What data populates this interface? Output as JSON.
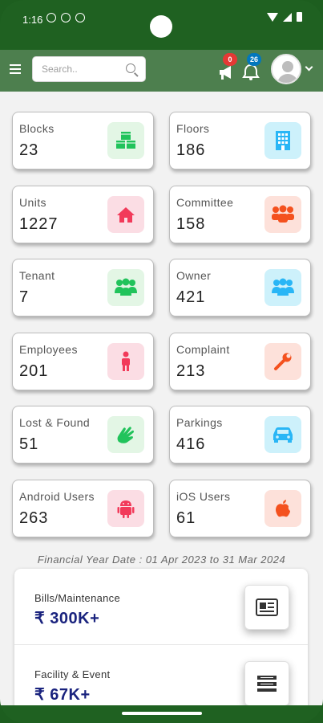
{
  "status": {
    "time": "1:16"
  },
  "search": {
    "placeholder": "Search.."
  },
  "notifications": [
    {
      "icon": "megaphone-icon",
      "badge": "0",
      "color": "#e53935"
    },
    {
      "icon": "bell-icon",
      "badge": "26",
      "color": "#0277bd"
    }
  ],
  "cards": [
    {
      "label": "Blocks",
      "value": "23",
      "icon": "cubes-icon",
      "bg": "#e3f6e5",
      "fg": "#21c35b"
    },
    {
      "label": "Floors",
      "value": "186",
      "icon": "building-icon",
      "bg": "#cdf1fb",
      "fg": "#29b6f6"
    },
    {
      "label": "Units",
      "value": "1227",
      "icon": "home-icon",
      "bg": "#fbdde4",
      "fg": "#f23a5a"
    },
    {
      "label": "Committee",
      "value": "158",
      "icon": "group-icon",
      "bg": "#fde1da",
      "fg": "#f4511e"
    },
    {
      "label": "Tenant",
      "value": "7",
      "icon": "users-icon",
      "bg": "#e3f6e5",
      "fg": "#21c35b"
    },
    {
      "label": "Owner",
      "value": "421",
      "icon": "users-icon",
      "bg": "#cdf1fb",
      "fg": "#29b6f6"
    },
    {
      "label": "Employees",
      "value": "201",
      "icon": "person-icon",
      "bg": "#fbdde4",
      "fg": "#f23a5a"
    },
    {
      "label": "Complaint",
      "value": "213",
      "icon": "wrench-icon",
      "bg": "#fde1da",
      "fg": "#f4511e"
    },
    {
      "label": "Lost & Found",
      "value": "51",
      "icon": "hand-icon",
      "bg": "#e3f6e5",
      "fg": "#21c35b"
    },
    {
      "label": "Parkings",
      "value": "416",
      "icon": "car-icon",
      "bg": "#cdf1fb",
      "fg": "#29b6f6"
    },
    {
      "label": "Android Users",
      "value": "263",
      "icon": "android-icon",
      "bg": "#fbdde4",
      "fg": "#f23a5a"
    },
    {
      "label": "iOS Users",
      "value": "61",
      "icon": "apple-icon",
      "bg": "#fde1da",
      "fg": "#f4511e"
    }
  ],
  "financial_year": "Financial Year Date : 01 Apr 2023 to 31 Mar 2024",
  "summary": [
    {
      "label": "Bills/Maintenance",
      "value": "₹ 300K+",
      "icon": "bill-icon"
    },
    {
      "label": "Facility & Event",
      "value": "₹ 67K+",
      "icon": "list-icon"
    }
  ]
}
